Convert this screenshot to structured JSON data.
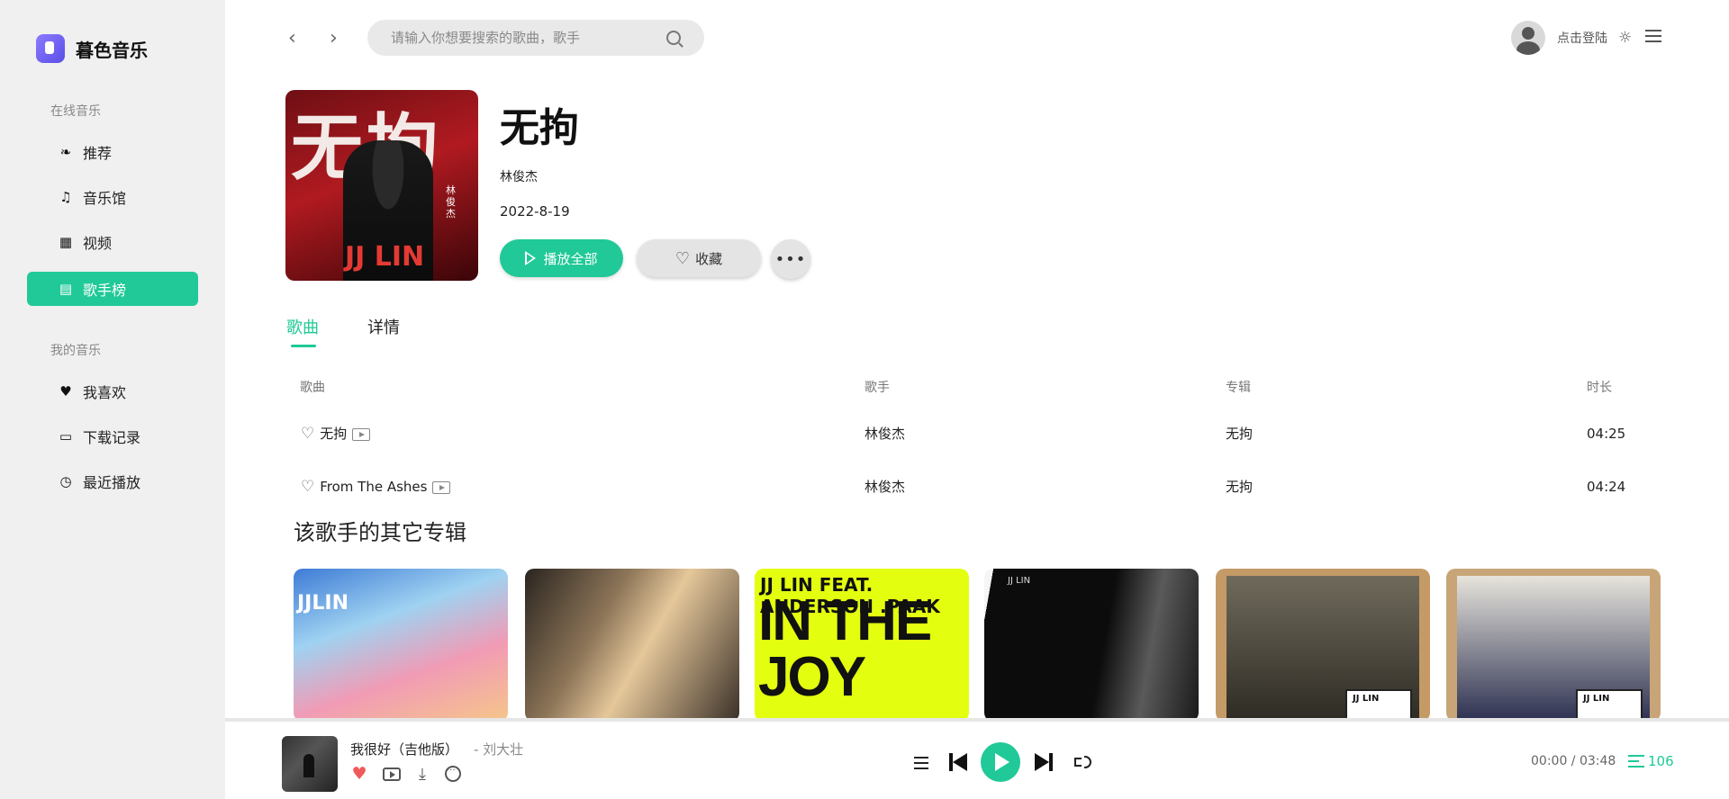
{
  "app": {
    "name": "暮色音乐"
  },
  "colors": {
    "accent": "#20c997",
    "sidebar_bg": "#f0f0f0",
    "heart_red": "#f15a5a"
  },
  "sidebar": {
    "online_title": "在线音乐",
    "online_items": [
      {
        "label": "推荐",
        "icon": "recommend-icon"
      },
      {
        "label": "音乐馆",
        "icon": "music-note-icon"
      },
      {
        "label": "视频",
        "icon": "video-icon"
      },
      {
        "label": "歌手榜",
        "icon": "chart-icon",
        "active": true
      }
    ],
    "mine_title": "我的音乐",
    "mine_items": [
      {
        "label": "我喜欢",
        "icon": "heart-icon"
      },
      {
        "label": "下载记录",
        "icon": "monitor-icon"
      },
      {
        "label": "最近播放",
        "icon": "clock-icon"
      }
    ]
  },
  "header": {
    "search_placeholder": "请输入你想要搜索的歌曲，歌手",
    "login_label": "点击登陆"
  },
  "album": {
    "title": "无拘",
    "artist": "林俊杰",
    "date": "2022-8-19",
    "play_all_label": "播放全部",
    "favorite_label": "收藏",
    "more_label": "•••",
    "cover_text": {
      "title": "无拘",
      "brand": "JJ LIN",
      "name_vertical": "林俊杰"
    }
  },
  "tabs": [
    {
      "label": "歌曲",
      "active": true
    },
    {
      "label": "详情",
      "active": false
    }
  ],
  "songs": {
    "columns": {
      "song": "歌曲",
      "artist": "歌手",
      "album": "专辑",
      "duration": "时长"
    },
    "rows": [
      {
        "title": "无拘",
        "artist": "林俊杰",
        "album": "无拘",
        "duration": "04:25"
      },
      {
        "title": "From The Ashes",
        "artist": "林俊杰",
        "album": "无拘",
        "duration": "04:24"
      }
    ]
  },
  "other_albums": {
    "heading": "该歌手的其它专辑",
    "items": [
      {
        "cover_text": "JJLIN"
      },
      {
        "cover_text": ""
      },
      {
        "cover_text_top": "JJ LIN   FEAT. ANDERSON .PAAK",
        "cover_text_main": "IN THE JOY"
      },
      {
        "cover_text": "JJ LIN"
      },
      {
        "cover_text": "JJ LIN"
      },
      {
        "cover_text": "JJ LIN"
      }
    ]
  },
  "player": {
    "title": "我很好（吉他版）",
    "artist": "- 刘大壮",
    "time": "00:00 / 03:48",
    "queue_count": "106"
  }
}
